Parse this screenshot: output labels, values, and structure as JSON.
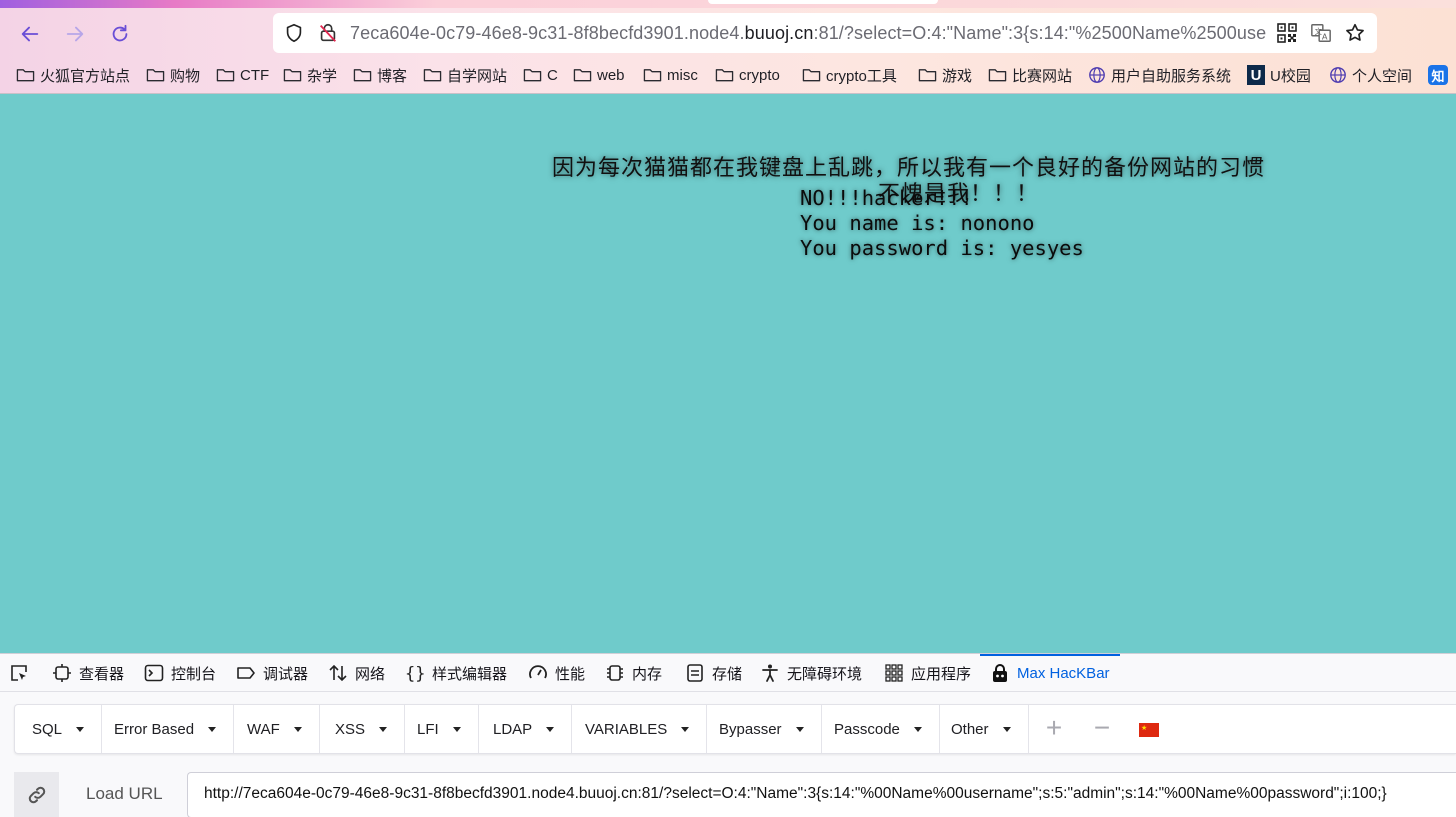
{
  "browser": {
    "url_prefix": "7eca604e-0c79-46e8-9c31-8f8becfd3901.node4.",
    "url_domain": "buuoj.cn",
    "url_suffix": ":81/?select=O:4:\"Name\":3{s:14:\"%2500Name%2500use",
    "icons": {
      "back": "back-arrow-icon",
      "forward": "forward-arrow-icon",
      "reload": "reload-icon",
      "shield": "shield-icon",
      "insecure": "insecure-lock-icon",
      "qr": "qr-code-icon",
      "translate": "translate-icon",
      "bookmark_star": "star-icon"
    }
  },
  "bookmarks": [
    {
      "label": "火狐官方站点",
      "icon": "folder-icon"
    },
    {
      "label": "购物",
      "icon": "folder-icon"
    },
    {
      "label": "CTF",
      "icon": "folder-icon"
    },
    {
      "label": "杂学",
      "icon": "folder-icon"
    },
    {
      "label": "博客",
      "icon": "folder-icon"
    },
    {
      "label": "自学网站",
      "icon": "folder-icon"
    },
    {
      "label": "C",
      "icon": "folder-icon"
    },
    {
      "label": "web",
      "icon": "folder-icon"
    },
    {
      "label": "misc",
      "icon": "folder-icon"
    },
    {
      "label": "crypto",
      "icon": "folder-icon"
    },
    {
      "label": "crypto工具",
      "icon": "folder-icon"
    },
    {
      "label": "游戏",
      "icon": "folder-icon"
    },
    {
      "label": "比赛网站",
      "icon": "folder-icon"
    },
    {
      "label": "用户自助服务系统",
      "icon": "globe-icon"
    },
    {
      "label": "U校园",
      "icon": "u-logo-icon"
    },
    {
      "label": "个人空间",
      "icon": "globe-icon"
    },
    {
      "label": "",
      "icon": "zhihu-icon",
      "glyph": "知"
    }
  ],
  "page": {
    "heading": "因为每次猫猫都在我键盘上乱跳，所以我有一个良好的备份网站的习惯",
    "sub": "不愧是我！！！",
    "line1": "NO!!!hacker!!!",
    "line2": "You name is: nonono",
    "line3": "You password is: yesyes"
  },
  "devtools": {
    "tabs": [
      {
        "label": "查看器",
        "icon": "inspector-icon"
      },
      {
        "label": "控制台",
        "icon": "console-icon"
      },
      {
        "label": "调试器",
        "icon": "debugger-icon"
      },
      {
        "label": "网络",
        "icon": "network-icon"
      },
      {
        "label": "样式编辑器",
        "icon": "style-editor-icon"
      },
      {
        "label": "性能",
        "icon": "performance-icon"
      },
      {
        "label": "内存",
        "icon": "memory-icon"
      },
      {
        "label": "存储",
        "icon": "storage-icon"
      },
      {
        "label": "无障碍环境",
        "icon": "accessibility-icon"
      },
      {
        "label": "应用程序",
        "icon": "application-icon"
      },
      {
        "label": "Max HacKBar",
        "icon": "hackbar-icon",
        "active": true
      }
    ],
    "picker_icon": "element-picker-icon",
    "accent": "#0061e0"
  },
  "hackbar": {
    "menus": [
      "SQL",
      "Error Based",
      "WAF",
      "XSS",
      "LFI",
      "LDAP",
      "VARIABLES",
      "Bypasser",
      "Passcode",
      "Other"
    ],
    "plus_label": "+",
    "minus_label": "−",
    "flag_icon": "china-flag-icon",
    "load_url_label": "Load URL",
    "link_icon": "link-icon",
    "url_value": "http://7eca604e-0c79-46e8-9c31-8f8becfd3901.node4.buuoj.cn:81/?select=O:4:\"Name\":3{s:14:\"%00Name%00username\";s:5:\"admin\";s:14:\"%00Name%00password\";i:100;}"
  },
  "colors": {
    "page_bg": "#6fcbcb",
    "active_tab": "#0061e0"
  }
}
